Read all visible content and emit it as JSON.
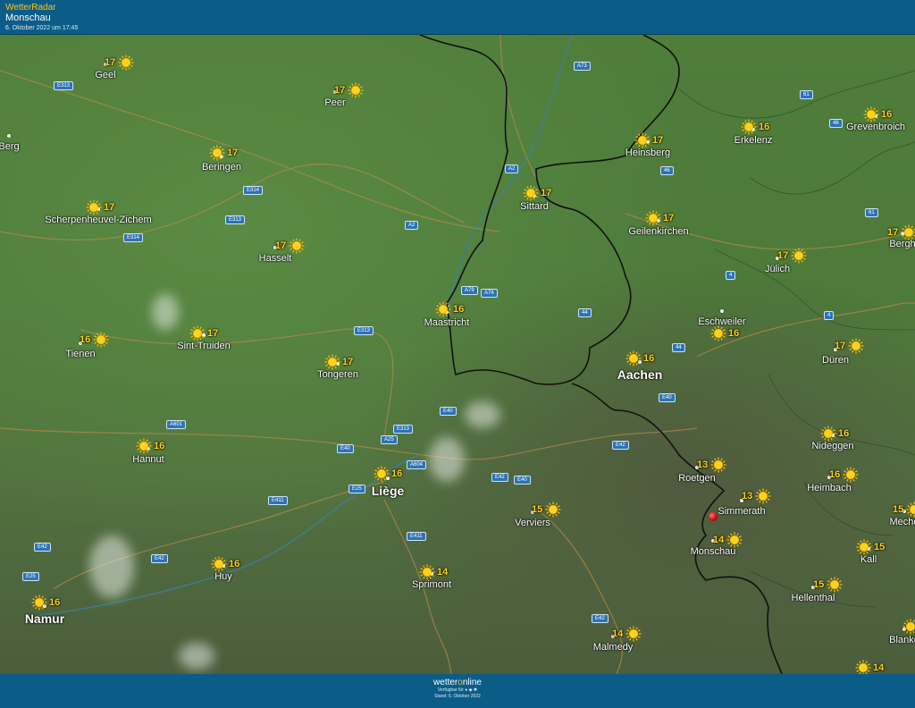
{
  "header": {
    "app_title": "WetterRadar",
    "location": "Monschau",
    "timestamp": "6. Oktober 2022 um 17:45"
  },
  "footer": {
    "brand_prefix": "wetter",
    "brand_accent": "o",
    "brand_suffix": "nline",
    "available_for": "Verfügbar für",
    "stand": "Stand: 6. Oktober 2022"
  },
  "colors": {
    "header_bg": "#0b5d88",
    "app_title": "#f7c51e",
    "temperature": "#ffd21e",
    "road_badge": "#2d73b4",
    "marker": "#d40000"
  },
  "cities": [
    {
      "name": "Geel",
      "temp": "17"
    },
    {
      "name": "Peer",
      "temp": "17"
    },
    {
      "name": "Berg",
      "temp": ""
    },
    {
      "name": "Beringen",
      "temp": "17"
    },
    {
      "name": "Scherpenheuvel-Zichem",
      "temp": "17"
    },
    {
      "name": "Hasselt",
      "temp": "17"
    },
    {
      "name": "Tienen",
      "temp": "16"
    },
    {
      "name": "Sint-Truiden",
      "temp": "17"
    },
    {
      "name": "Tongeren",
      "temp": "17"
    },
    {
      "name": "Maastricht",
      "temp": "16"
    },
    {
      "name": "Sittard",
      "temp": "17"
    },
    {
      "name": "Heinsberg",
      "temp": "17"
    },
    {
      "name": "Erkelenz",
      "temp": "16"
    },
    {
      "name": "Grevenbroich",
      "temp": "16"
    },
    {
      "name": "Geilenkirchen",
      "temp": "17"
    },
    {
      "name": "Jülich",
      "temp": "17"
    },
    {
      "name": "Bergh",
      "temp": "17"
    },
    {
      "name": "Eschweiler",
      "temp": "16"
    },
    {
      "name": "Düren",
      "temp": "17"
    },
    {
      "name": "Aachen",
      "temp": "16"
    },
    {
      "name": "Hannut",
      "temp": "16"
    },
    {
      "name": "Liège",
      "temp": "16"
    },
    {
      "name": "Verviers",
      "temp": "15"
    },
    {
      "name": "Roetgen",
      "temp": "13"
    },
    {
      "name": "Nideggen",
      "temp": "16"
    },
    {
      "name": "Heimbach",
      "temp": "16"
    },
    {
      "name": "Simmerath",
      "temp": "13"
    },
    {
      "name": "Monschau",
      "temp": "14"
    },
    {
      "name": "Meche",
      "temp": "15"
    },
    {
      "name": "Kall",
      "temp": "15"
    },
    {
      "name": "Huy",
      "temp": "16"
    },
    {
      "name": "Sprimont",
      "temp": "14"
    },
    {
      "name": "Namur",
      "temp": "16"
    },
    {
      "name": "Hellenthal",
      "temp": "15"
    },
    {
      "name": "Malmedy",
      "temp": "14"
    },
    {
      "name": "Blanke",
      "temp": ""
    },
    {
      "name": "",
      "temp": "14"
    }
  ],
  "roads": [
    "E313",
    "A73",
    "A2",
    "46",
    "61",
    "46",
    "E314",
    "E313",
    "E314",
    "A2",
    "A79",
    "A76",
    "44",
    "4",
    "61",
    "E313",
    "4",
    "44",
    "E40",
    "A601",
    "E313",
    "E40",
    "A25",
    "A604",
    "E25",
    "E40",
    "E42",
    "E40",
    "E42",
    "E411",
    "E42",
    "E42",
    "E25",
    "E42",
    "E411"
  ]
}
